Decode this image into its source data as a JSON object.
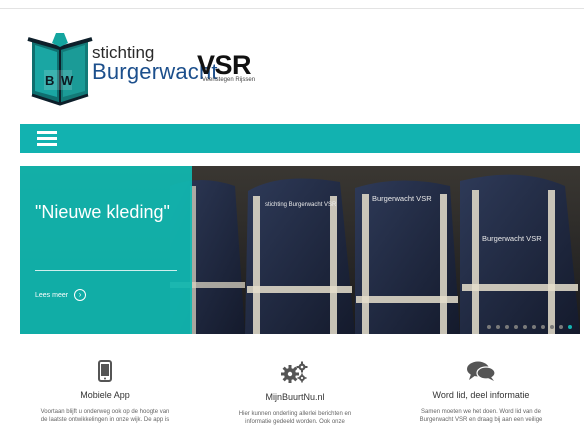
{
  "logo": {
    "line1": "stichting",
    "line2": "Burgerwacht",
    "line3": "VSR",
    "tagline": "Veenstegen Rijssen",
    "initials_b": "B",
    "initials_w": "W"
  },
  "nav": {
    "menu_icon": "hamburger-icon"
  },
  "slider": {
    "caption_title": "\"Nieuwe kleding\"",
    "read_more": "Lees meer",
    "jacket_text": "Burgerwacht VSR",
    "jacket_text_small": "stichting Burgerwacht VSR",
    "dot_count": 10,
    "active_dot": 10
  },
  "features": [
    {
      "icon": "mobile-phone-icon",
      "title": "Mobiele App",
      "text_1": "Voortaan blijft u onderweg ook op de hoogte van",
      "text_2": "de laatste ontwikkelingen in onze wijk. De app is"
    },
    {
      "icon": "gears-icon",
      "title": "MijnBuurtNu.nl",
      "text_1": "Hier kunnen onderling allerlei berichten en",
      "text_2": "informatie gedeeld worden. Ook onze"
    },
    {
      "icon": "chat-bubbles-icon",
      "title": "Word lid, deel informatie",
      "text_1": "Samen moeten we het doen. Word lid van de",
      "text_2": "Burgerwacht VSR en draag bij aan een veilige"
    }
  ],
  "colors": {
    "accent": "#12b2b0",
    "logo_blue": "#1c4f8c"
  }
}
